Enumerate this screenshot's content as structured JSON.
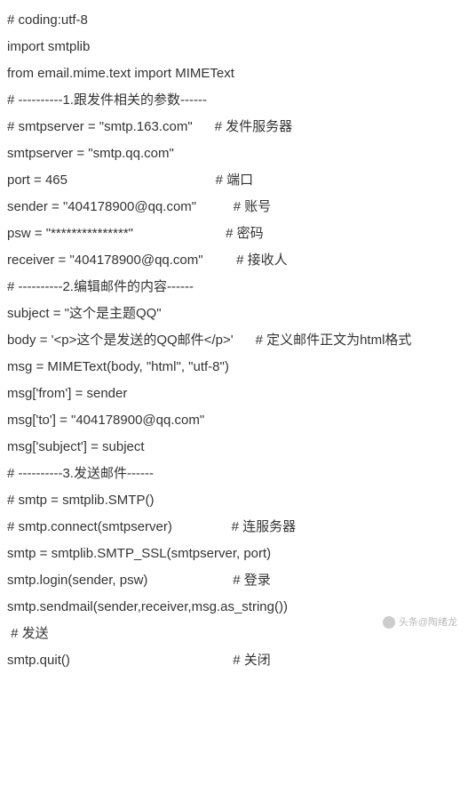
{
  "lines": [
    "# coding:utf-8",
    "import smtplib",
    "from email.mime.text import MIMEText",
    "",
    "# ----------1.跟发件相关的参数------",
    "# smtpserver = \"smtp.163.com\"      # 发件服务器",
    "smtpserver = \"smtp.qq.com\"",
    "port = 465                                        # 端口",
    "sender = \"404178900@qq.com\"          # 账号",
    "psw = \"***************\"                         # 密码",
    "receiver = \"404178900@qq.com\"         # 接收人",
    "",
    "# ----------2.编辑邮件的内容------",
    "subject = \"这个是主题QQ\"",
    "body = '<p>这个是发送的QQ邮件</p>'      # 定义邮件正文为html格式",
    "msg = MIMEText(body, \"html\", \"utf-8\")",
    "msg['from'] = sender",
    "msg['to'] = \"404178900@qq.com\"",
    "msg['subject'] = subject",
    "",
    "# ----------3.发送邮件------",
    "# smtp = smtplib.SMTP()",
    "# smtp.connect(smtpserver)                # 连服务器",
    "smtp = smtplib.SMTP_SSL(smtpserver, port)",
    "smtp.login(sender, psw)                       # 登录",
    "smtp.sendmail(sender,receiver,msg.as_string())",
    " # 发送",
    "smtp.quit()                                            # 关闭"
  ],
  "watermark": "头条@陶绪龙"
}
